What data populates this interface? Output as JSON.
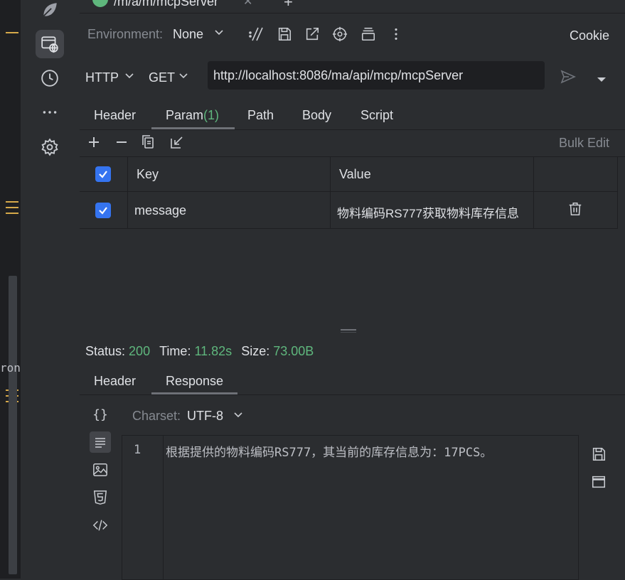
{
  "tab_path": "/m/a/m/mcpServer",
  "environment": {
    "label": "Environment:",
    "value": "None"
  },
  "cookie_label": "Cookie",
  "request": {
    "protocol": "HTTP",
    "method": "GET",
    "url": "http://localhost:8086/ma/api/mcp/mcpServer"
  },
  "request_tabs": {
    "header": "Header",
    "param": "Param",
    "param_count": "(1)",
    "path": "Path",
    "body": "Body",
    "script": "Script"
  },
  "bulk_edit": "Bulk Edit",
  "params_table": {
    "col_key": "Key",
    "col_value": "Value",
    "rows": [
      {
        "key": "message",
        "value": "物料编码RS777获取物料库存信息"
      }
    ]
  },
  "status": {
    "status_label": "Status:",
    "status_value": "200",
    "time_label": "Time:",
    "time_value": "11.82s",
    "size_label": "Size:",
    "size_value": "73.00B"
  },
  "response_tabs": {
    "header": "Header",
    "response": "Response"
  },
  "charset": {
    "label": "Charset:",
    "value": "UTF-8"
  },
  "response_body": {
    "line_number": "1",
    "line_text": "根据提供的物料编码RS777，其当前的库存信息为：17PCS。"
  },
  "editor_fragment": "ron",
  "colors": {
    "accent": "#3574f0",
    "success": "#5fb77d",
    "gutter_mark": "#d6a94a",
    "background": "#2b2d30",
    "input_background": "#1e1f22"
  }
}
